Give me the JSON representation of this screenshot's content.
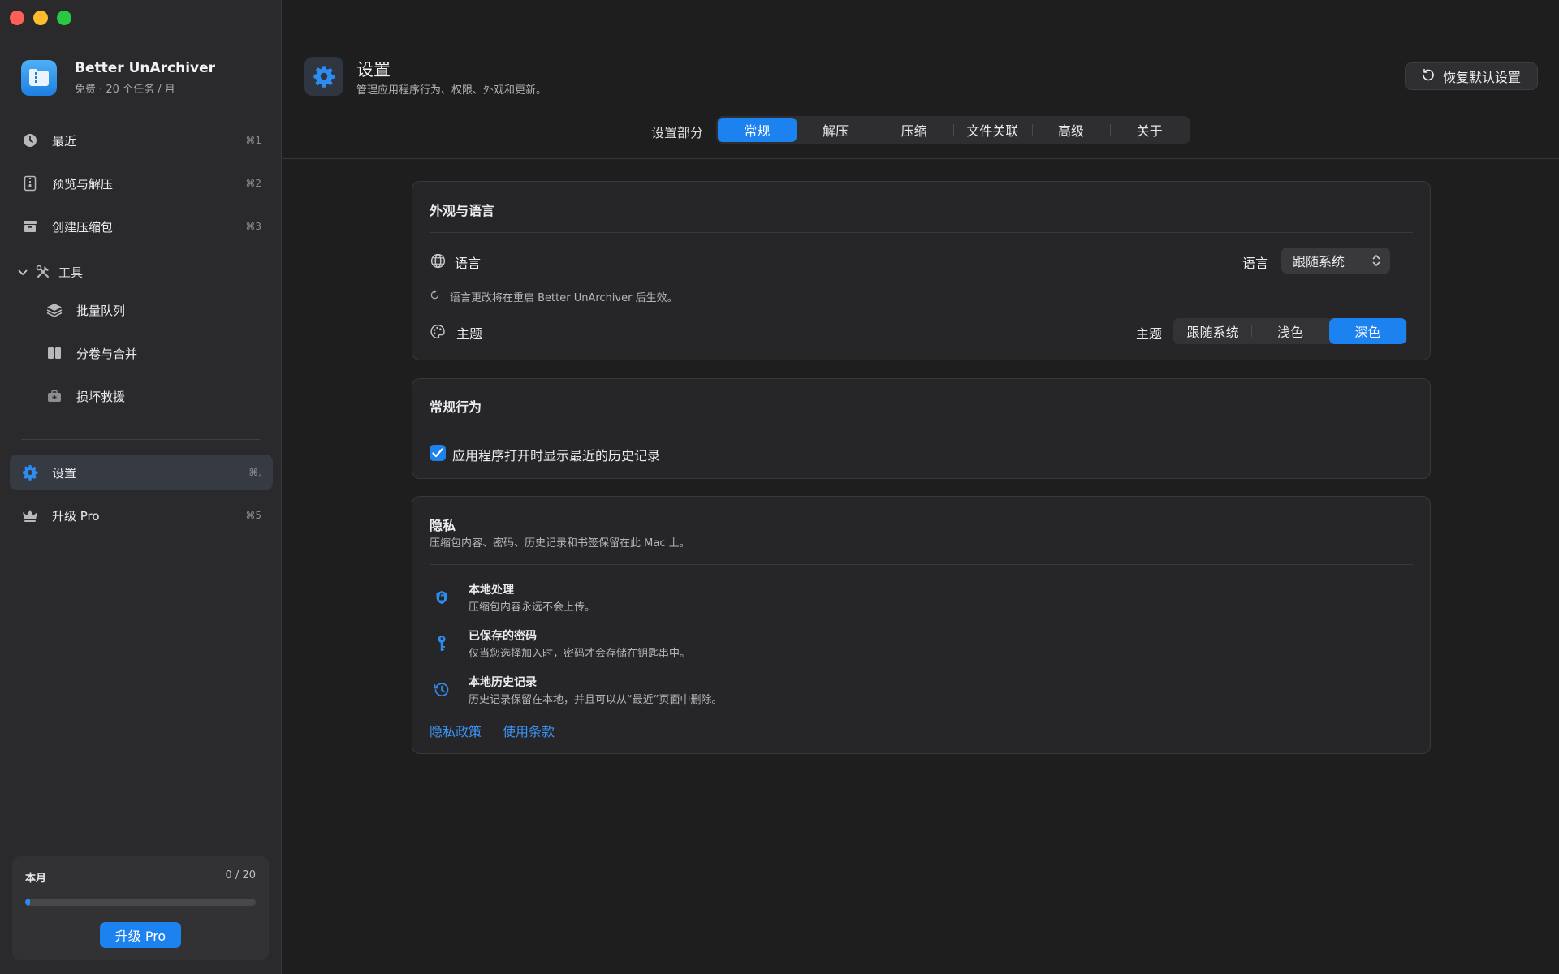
{
  "app": {
    "name": "Better UnArchiver",
    "plan": "免费 · 20 个任务 / 月"
  },
  "sidebar": {
    "items": [
      {
        "label": "最近",
        "shortcut": "⌘1",
        "icon": "clock-icon"
      },
      {
        "label": "预览与解压",
        "shortcut": "⌘2",
        "icon": "archive-zip-icon"
      },
      {
        "label": "创建压缩包",
        "shortcut": "⌘3",
        "icon": "box-icon"
      }
    ],
    "tools_label": "工具",
    "tools": [
      {
        "label": "批量队列",
        "icon": "stack-icon"
      },
      {
        "label": "分卷与合并",
        "icon": "split-icon"
      },
      {
        "label": "损坏救援",
        "icon": "first-aid-icon"
      }
    ],
    "settings": {
      "label": "设置",
      "shortcut": "⌘,"
    },
    "upgrade": {
      "label": "升级 Pro",
      "shortcut": "⌘5"
    },
    "usage": {
      "label": "本月",
      "count": "0 / 20",
      "progress": 0.02,
      "button": "升级 Pro"
    }
  },
  "header": {
    "title": "设置",
    "subtitle": "管理应用程序行为、权限、外观和更新。",
    "reset_button": "恢复默认设置",
    "section_label": "设置部分",
    "tabs": [
      "常规",
      "解压",
      "压缩",
      "文件关联",
      "高级",
      "关于"
    ],
    "active_tab": 0
  },
  "appearance": {
    "title": "外观与语言",
    "language_label": "语言",
    "language_field_label": "语言",
    "language_value": "跟随系统",
    "language_hint": "语言更改将在重启 Better UnArchiver 后生效。",
    "theme_label": "主题",
    "theme_field_label": "主题",
    "theme_options": [
      "跟随系统",
      "浅色",
      "深色"
    ],
    "theme_active": 2
  },
  "behavior": {
    "title": "常规行为",
    "show_history_label": "应用程序打开时显示最近的历史记录",
    "show_history_checked": true
  },
  "privacy": {
    "title": "隐私",
    "subtitle": "压缩包内容、密码、历史记录和书签保留在此 Mac 上。",
    "items": [
      {
        "title": "本地处理",
        "desc": "压缩包内容永远不会上传。",
        "icon": "shield-icon"
      },
      {
        "title": "已保存的密码",
        "desc": "仅当您选择加入时，密码才会存储在钥匙串中。",
        "icon": "key-icon"
      },
      {
        "title": "本地历史记录",
        "desc": "历史记录保留在本地，并且可以从“最近”页面中删除。",
        "icon": "history-icon"
      }
    ],
    "links": [
      "隐私政策",
      "使用条款"
    ]
  },
  "colors": {
    "accent": "#1b82f0",
    "background": "#1e1e1f",
    "sidebar": "#2a2a2c"
  }
}
